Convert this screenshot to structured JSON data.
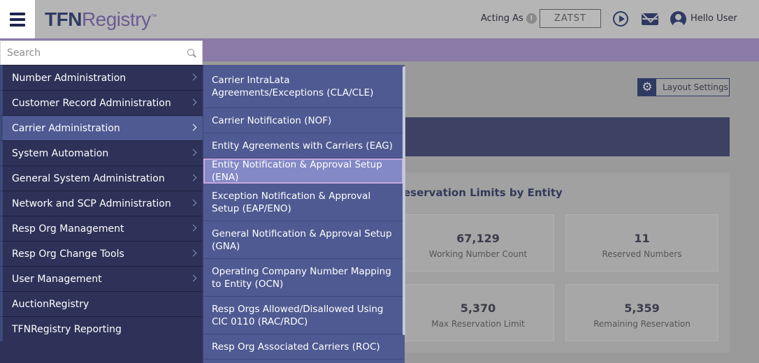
{
  "header": {
    "logo_part1": "TFN",
    "logo_part2": "Registry",
    "logo_tm": "™",
    "acting_as_label": "Acting As",
    "resp_org": "ZATST",
    "greeting": "Hello User"
  },
  "layout_settings_label": "Layout Settings",
  "panel": {
    "title": "eservation Limits by Entity",
    "stats": [
      {
        "value": "67,129",
        "label": "Working Number Count"
      },
      {
        "value": "11",
        "label": "Reserved Numbers"
      },
      {
        "value": "5,370",
        "label": "Max Reservation Limit"
      },
      {
        "value": "5,359",
        "label": "Remaining Reservation"
      }
    ]
  },
  "search": {
    "placeholder": "Search",
    "value": ""
  },
  "menu": {
    "items": [
      {
        "label": "Number Administration"
      },
      {
        "label": "Customer Record Administration"
      },
      {
        "label": "Carrier Administration"
      },
      {
        "label": "System Automation"
      },
      {
        "label": "General System Administration"
      },
      {
        "label": "Network and SCP Administration"
      },
      {
        "label": "Resp Org Management"
      },
      {
        "label": "Resp Org Change Tools"
      },
      {
        "label": "User Management"
      },
      {
        "label": "AuctionRegistry"
      },
      {
        "label": "TFNRegistry Reporting"
      }
    ],
    "active_item": "Carrier Administration"
  },
  "submenu": {
    "items": [
      {
        "label": "Carrier IntraLata Agreements/Exceptions (CLA/CLE)"
      },
      {
        "label": "Carrier Notification (NOF)"
      },
      {
        "label": "Entity Agreements with Carriers (EAG)"
      },
      {
        "label": "Entity Notification & Approval Setup (ENA)"
      },
      {
        "label": "Exception Notification & Approval Setup (EAP/ENO)"
      },
      {
        "label": "General Notification & Approval Setup (GNA)"
      },
      {
        "label": "Operating Company Number Mapping to Entity (OCN)"
      },
      {
        "label": "Resp Orgs Allowed/Disallowed Using CIC 0110 (RAC/RDC)"
      },
      {
        "label": "Resp Org Associated Carriers (ROC)"
      }
    ],
    "highlighted_item": "Entity Notification & Approval Setup (ENA)"
  },
  "colors": {
    "menu_bg": "#2e3258",
    "submenu_bg": "#4f5a92",
    "highlight_bg": "#8388c6",
    "header_bg": "#b5b5b5",
    "accent_bar": "#8a7aa8"
  }
}
